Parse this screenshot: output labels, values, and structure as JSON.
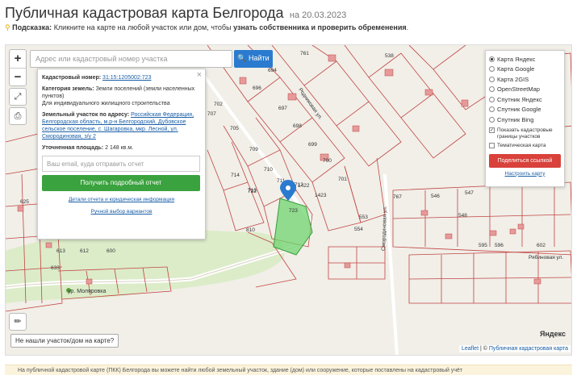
{
  "header": {
    "title": "Публичная кадастровая карта Белгорода",
    "date": "на 20.03.2023"
  },
  "hint": {
    "label": "Подсказка:",
    "text": "Кликните на карте на любой участок или дом, чтобы",
    "bold": "узнать собственника и проверить обременения",
    "end": "."
  },
  "search": {
    "placeholder": "Адрес или кадастровый номер участка",
    "button": "Найти",
    "icon": "search-icon"
  },
  "zoom": {
    "in": "+",
    "out": "−"
  },
  "card": {
    "cad_label": "Кадастровый номер:",
    "cad_value": "31:15:1205002:723",
    "category_label": "Категория земель:",
    "category_value": "Земли поселений (земли населенных пунктов)",
    "use_value": "Для индивидуального жилищного строительства",
    "address_label": "Земельный участок по адресу:",
    "address_value": "Российская Федерация, Белгородская область, м.р-н Белгородский, Дубовское сельское поселение, с. Шагаровка, мкр. Лесной, ул. Смородиновая, з/у 2",
    "area_label": "Уточненная площадь:",
    "area_value": "2 148 кв.м.",
    "email_placeholder": "Ваш email, куда отправить отчет",
    "get_report": "Получить подробный отчет",
    "details_link": "Детали отчета и юридическая информация",
    "manual_link": "Ручной выбор вариантов",
    "close": "×"
  },
  "layers": {
    "options": [
      "Карта Яндекс",
      "Карта Google",
      "Карта 2GIS",
      "OpenStreetMap",
      "Спутник Яндекс",
      "Спутник Google",
      "Спутник Bing"
    ],
    "selected": 0,
    "show_borders": "Показать кадастровые границы участков",
    "thematic": "Тематическая карта",
    "share": "Поделиться ссылкой",
    "setup": "Настроить карту"
  },
  "map": {
    "not_found": "Не нашли участок/дом на карте?",
    "yandex": "Яндекс",
    "attrib_leaflet": "Leaflet",
    "attrib_sep": " | © ",
    "attrib_site": "Публичная кадастровая карта",
    "street_mol": "ур. Моляровка",
    "street_ryab": "Рябиновая ул.",
    "street_smor": "Смородиновая ул.",
    "street_zol": "Родниковая ул.",
    "plot_labels": [
      "761",
      "538",
      "696",
      "694",
      "697",
      "698",
      "699",
      "700",
      "701",
      "702",
      "707",
      "705",
      "709",
      "710",
      "711",
      "712",
      "713",
      "714",
      "722",
      "723",
      "1422",
      "1423",
      "625",
      "633",
      "810",
      "613",
      "612",
      "600",
      "547",
      "546",
      "548",
      "553",
      "554",
      "595",
      "596",
      "602",
      "767",
      "635",
      "543",
      "542",
      "541",
      "536",
      "537",
      "539",
      "551",
      "584",
      "587",
      "539",
      "626",
      "629",
      "543",
      "597",
      "596",
      "1"
    ]
  },
  "bottom_note": "На публичной кадастровой карте (ПКК) Белгорода вы можете найти любой земельный участок, здание (дом) или сооружение, которые поставлены на кадастровый учёт"
}
